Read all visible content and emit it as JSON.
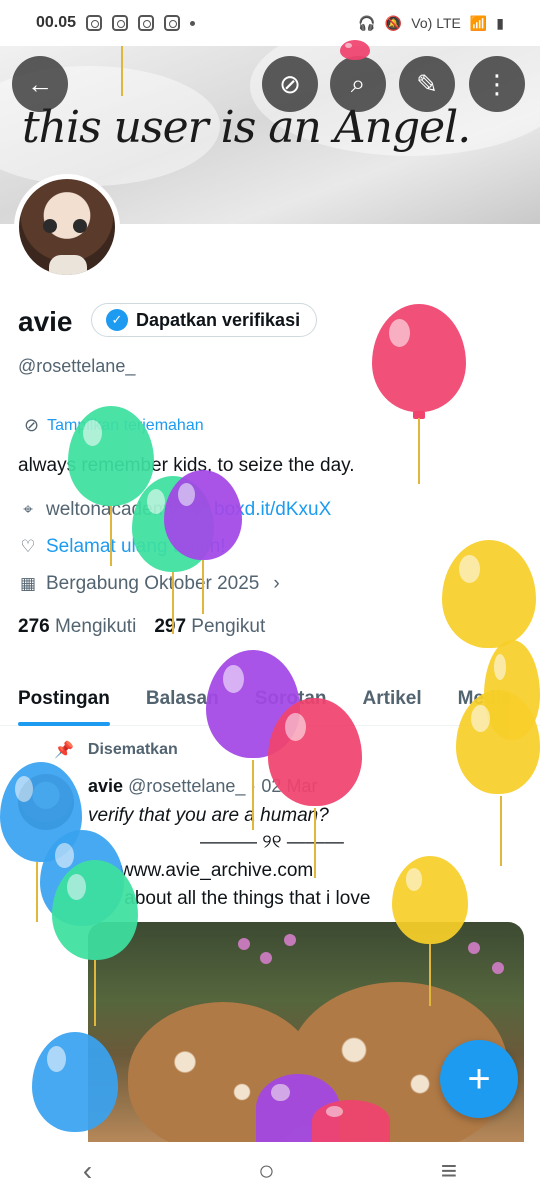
{
  "status_bar": {
    "time": "00.05",
    "indicators": "Vo) LTE"
  },
  "banner": {
    "text": "this user is an Angel."
  },
  "profile": {
    "name": "avie",
    "verify_label": "Dapatkan verifikasi",
    "handle": "@rosettelane_",
    "translate_label": "Tampilkan terjemahan",
    "bio": "always remember kids, to seize the day.",
    "location": "weltonacademy",
    "website": "boxd.it/dKxuX",
    "birthday": "Selamat ulang tahun!",
    "joined": "Bergabung Oktober 2025",
    "following_count": "276",
    "following_label": "Mengikuti",
    "followers_count": "297",
    "followers_label": "Pengikut"
  },
  "tabs": [
    {
      "label": "Postingan",
      "active": true
    },
    {
      "label": "Balasan",
      "active": false
    },
    {
      "label": "Sorotan",
      "active": false
    },
    {
      "label": "Artikel",
      "active": false
    },
    {
      "label": "Media",
      "active": false
    }
  ],
  "post": {
    "pinned_label": "Disematkan",
    "author": "avie",
    "handle": "@rosettelane_",
    "date": "· 02 Mar",
    "line1": "verify that you are a human?",
    "line2": "——— ୨୧ ———",
    "line3": "www.avie_archive.com",
    "line4": "— about all the things that i love"
  },
  "colors": {
    "accent": "#1d9bf0",
    "balloon_red": "#f0436e",
    "balloon_green": "#3ee0a0",
    "balloon_purple": "#a347e6",
    "balloon_yellow": "#f7cf2a",
    "balloon_blue": "#3aa3f0"
  },
  "icons": [
    "back-arrow-icon",
    "translate-off-icon",
    "search-icon",
    "edit-icon",
    "more-icon",
    "location-icon",
    "link-icon",
    "balloon-icon",
    "calendar-icon",
    "pin-icon",
    "plus-icon"
  ]
}
